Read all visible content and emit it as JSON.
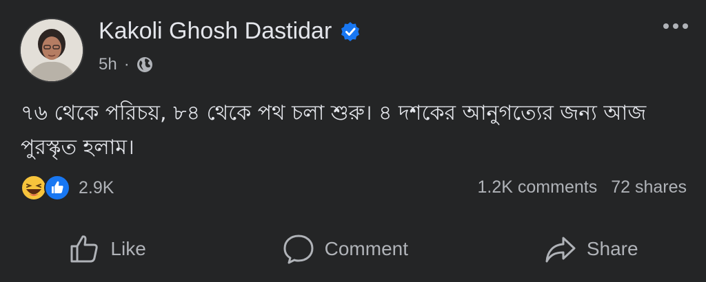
{
  "post": {
    "author": "Kakoli Ghosh Dastidar",
    "time": "5h",
    "separator": "·",
    "privacy_icon": "globe-icon",
    "verified_icon": "verified-badge-icon",
    "text": "৭৬ থেকে পরিচয়, ৮৪ থেকে পথ চলা শুরু। ৪ দশকের আনুগত্যের জন্য আজ পুরস্কৃত হলাম।"
  },
  "reactions": {
    "icons": [
      "haha-icon",
      "like-icon"
    ],
    "count": "2.9K"
  },
  "stats": {
    "comments": "1.2K comments",
    "shares": "72 shares"
  },
  "actions": {
    "like": "Like",
    "comment": "Comment",
    "share": "Share"
  },
  "colors": {
    "background": "#242526",
    "text_primary": "#e4e6eb",
    "text_secondary": "#b0b3b8",
    "verified_blue": "#1877f2"
  }
}
